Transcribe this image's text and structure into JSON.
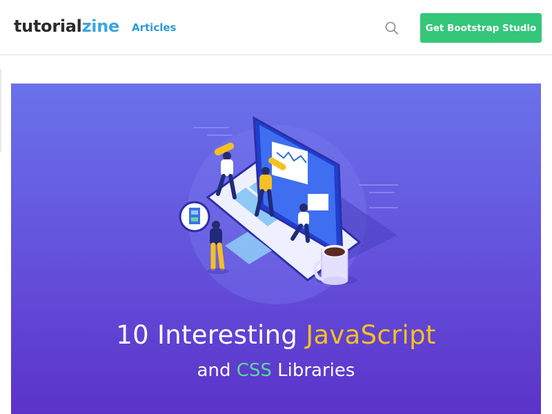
{
  "header": {
    "logo_main": "tutorial",
    "logo_accent": "zine",
    "nav": {
      "articles_label": "Articles"
    },
    "search_icon": "search-icon",
    "cta_label": "Get Bootstrap Studio"
  },
  "hero": {
    "title_part1": "10 Interesting ",
    "title_highlight": "JavaScript",
    "subtitle_part1": "and ",
    "subtitle_highlight": "CSS",
    "subtitle_part2": " Libraries"
  },
  "colors": {
    "brand_blue": "#3aa6de",
    "cta_green": "#34c679",
    "hero_top": "#6a72ea",
    "hero_bottom": "#5b33c9",
    "highlight_yellow": "#f5c023",
    "highlight_green": "#5ad8a0"
  }
}
